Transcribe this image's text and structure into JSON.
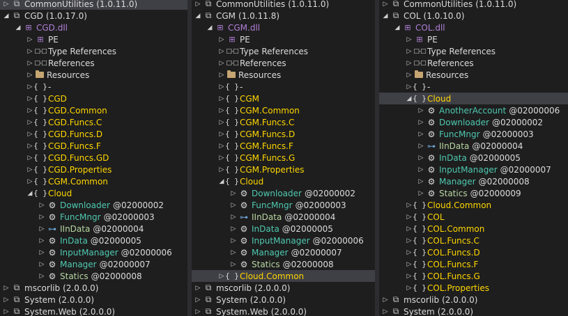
{
  "panels": [
    {
      "rows": [
        {
          "indent": 0,
          "exp": "▷",
          "icon": "assembly-icon",
          "label": "CommonUtilities",
          "version": "(1.0.11.0)",
          "kind": "plain",
          "sel": true
        },
        {
          "indent": 0,
          "exp": "◢",
          "icon": "assembly-icon",
          "label": "CGD",
          "version": "(1.0.17.0)",
          "kind": "plain"
        },
        {
          "indent": 1,
          "exp": "◢",
          "icon": "dll-icon",
          "label": "CGD.dll",
          "kind": "dll"
        },
        {
          "indent": 2,
          "exp": "▷",
          "icon": "pe-icon",
          "label": "PE",
          "kind": "plain"
        },
        {
          "indent": 2,
          "exp": "▷",
          "icon": "references-icon",
          "label": "Type References",
          "kind": "plain"
        },
        {
          "indent": 2,
          "exp": "▷",
          "icon": "references-icon",
          "label": "References",
          "kind": "plain"
        },
        {
          "indent": 2,
          "exp": "▷",
          "icon": "folder-icon",
          "label": "Resources",
          "kind": "plain"
        },
        {
          "indent": 2,
          "exp": "▷",
          "icon": "namespace-icon",
          "label": "-",
          "kind": "plain"
        },
        {
          "indent": 2,
          "exp": "▷",
          "icon": "namespace-icon",
          "label": "CGD",
          "kind": "ns"
        },
        {
          "indent": 2,
          "exp": "▷",
          "icon": "namespace-icon",
          "label": "CGD.Common",
          "kind": "ns"
        },
        {
          "indent": 2,
          "exp": "▷",
          "icon": "namespace-icon",
          "label": "CGD.Funcs.C",
          "kind": "ns"
        },
        {
          "indent": 2,
          "exp": "▷",
          "icon": "namespace-icon",
          "label": "CGD.Funcs.D",
          "kind": "ns"
        },
        {
          "indent": 2,
          "exp": "▷",
          "icon": "namespace-icon",
          "label": "CGD.Funcs.F",
          "kind": "ns"
        },
        {
          "indent": 2,
          "exp": "▷",
          "icon": "namespace-icon",
          "label": "CGD.Funcs.GD",
          "kind": "ns"
        },
        {
          "indent": 2,
          "exp": "▷",
          "icon": "namespace-icon",
          "label": "CGD.Properties",
          "kind": "ns"
        },
        {
          "indent": 2,
          "exp": "▷",
          "icon": "namespace-icon",
          "label": "CGM.Common",
          "kind": "ns"
        },
        {
          "indent": 2,
          "exp": "◢",
          "icon": "namespace-icon",
          "label": "Cloud",
          "kind": "ns"
        },
        {
          "indent": 3,
          "exp": "▷",
          "icon": "class-icon",
          "label": "Downloader",
          "token": "@02000002",
          "kind": "type"
        },
        {
          "indent": 3,
          "exp": "▷",
          "icon": "class-icon",
          "label": "FuncMngr",
          "token": "@02000003",
          "kind": "type"
        },
        {
          "indent": 3,
          "exp": "▷",
          "icon": "interface-icon",
          "label": "IInData",
          "token": "@02000004",
          "kind": "iface"
        },
        {
          "indent": 3,
          "exp": "▷",
          "icon": "class-icon",
          "label": "InData",
          "token": "@02000005",
          "kind": "type"
        },
        {
          "indent": 3,
          "exp": "▷",
          "icon": "class-icon",
          "label": "InputManager",
          "token": "@02000006",
          "kind": "type"
        },
        {
          "indent": 3,
          "exp": "▷",
          "icon": "class-icon",
          "label": "Manager",
          "token": "@02000007",
          "kind": "type"
        },
        {
          "indent": 3,
          "exp": "▷",
          "icon": "class-icon",
          "label": "Statics",
          "token": "@02000008",
          "kind": "iface"
        },
        {
          "indent": 0,
          "exp": "▷",
          "icon": "assembly-icon",
          "label": "mscorlib",
          "version": "(2.0.0.0)",
          "kind": "plain"
        },
        {
          "indent": 0,
          "exp": "▷",
          "icon": "assembly-icon",
          "label": "System",
          "version": "(2.0.0.0)",
          "kind": "plain"
        },
        {
          "indent": 0,
          "exp": "▷",
          "icon": "assembly-icon",
          "label": "System.Web",
          "version": "(2.0.0.0)",
          "kind": "plain"
        }
      ]
    },
    {
      "rows": [
        {
          "indent": 0,
          "exp": "▷",
          "icon": "assembly-icon",
          "label": "CommonUtilities",
          "version": "(1.0.11.0)",
          "kind": "plain"
        },
        {
          "indent": 0,
          "exp": "◢",
          "icon": "assembly-icon",
          "label": "CGM",
          "version": "(1.0.11.8)",
          "kind": "plain"
        },
        {
          "indent": 1,
          "exp": "◢",
          "icon": "dll-icon",
          "label": "CGM.dll",
          "kind": "dll"
        },
        {
          "indent": 2,
          "exp": "▷",
          "icon": "pe-icon",
          "label": "PE",
          "kind": "plain"
        },
        {
          "indent": 2,
          "exp": "▷",
          "icon": "references-icon",
          "label": "Type References",
          "kind": "plain"
        },
        {
          "indent": 2,
          "exp": "▷",
          "icon": "references-icon",
          "label": "References",
          "kind": "plain"
        },
        {
          "indent": 2,
          "exp": "▷",
          "icon": "folder-icon",
          "label": "Resources",
          "kind": "plain"
        },
        {
          "indent": 2,
          "exp": "▷",
          "icon": "namespace-icon",
          "label": "-",
          "kind": "plain"
        },
        {
          "indent": 2,
          "exp": "▷",
          "icon": "namespace-icon",
          "label": "CGM",
          "kind": "ns"
        },
        {
          "indent": 2,
          "exp": "▷",
          "icon": "namespace-icon",
          "label": "CGM.Common",
          "kind": "ns"
        },
        {
          "indent": 2,
          "exp": "▷",
          "icon": "namespace-icon",
          "label": "CGM.Funcs.C",
          "kind": "ns"
        },
        {
          "indent": 2,
          "exp": "▷",
          "icon": "namespace-icon",
          "label": "CGM.Funcs.D",
          "kind": "ns"
        },
        {
          "indent": 2,
          "exp": "▷",
          "icon": "namespace-icon",
          "label": "CGM.Funcs.F",
          "kind": "ns"
        },
        {
          "indent": 2,
          "exp": "▷",
          "icon": "namespace-icon",
          "label": "CGM.Funcs.G",
          "kind": "ns"
        },
        {
          "indent": 2,
          "exp": "▷",
          "icon": "namespace-icon",
          "label": "CGM.Properties",
          "kind": "ns"
        },
        {
          "indent": 2,
          "exp": "◢",
          "icon": "namespace-icon",
          "label": "Cloud",
          "kind": "ns"
        },
        {
          "indent": 3,
          "exp": "▷",
          "icon": "class-icon",
          "label": "Downloader",
          "token": "@02000002",
          "kind": "type"
        },
        {
          "indent": 3,
          "exp": "▷",
          "icon": "class-icon",
          "label": "FuncMngr",
          "token": "@02000003",
          "kind": "type"
        },
        {
          "indent": 3,
          "exp": "▷",
          "icon": "interface-icon",
          "label": "IInData",
          "token": "@02000004",
          "kind": "iface"
        },
        {
          "indent": 3,
          "exp": "▷",
          "icon": "class-icon",
          "label": "InData",
          "token": "@02000005",
          "kind": "type"
        },
        {
          "indent": 3,
          "exp": "▷",
          "icon": "class-icon",
          "label": "InputManager",
          "token": "@02000006",
          "kind": "type"
        },
        {
          "indent": 3,
          "exp": "▷",
          "icon": "class-icon",
          "label": "Manager",
          "token": "@02000007",
          "kind": "type"
        },
        {
          "indent": 3,
          "exp": "▷",
          "icon": "class-icon",
          "label": "Statics",
          "token": "@02000008",
          "kind": "iface"
        },
        {
          "indent": 2,
          "exp": "▷",
          "icon": "namespace-icon",
          "label": "Cloud.Common",
          "kind": "ns",
          "sel": true
        },
        {
          "indent": 0,
          "exp": "▷",
          "icon": "assembly-icon",
          "label": "mscorlib",
          "version": "(2.0.0.0)",
          "kind": "plain"
        },
        {
          "indent": 0,
          "exp": "▷",
          "icon": "assembly-icon",
          "label": "System",
          "version": "(2.0.0.0)",
          "kind": "plain"
        },
        {
          "indent": 0,
          "exp": "▷",
          "icon": "assembly-icon",
          "label": "System.Web",
          "version": "(2.0.0.0)",
          "kind": "plain"
        }
      ]
    },
    {
      "rows": [
        {
          "indent": 0,
          "exp": "▷",
          "icon": "assembly-icon",
          "label": "CommonUtilities",
          "version": "(1.0.11.0)",
          "kind": "plain"
        },
        {
          "indent": 0,
          "exp": "◢",
          "icon": "assembly-icon",
          "label": "COL",
          "version": "(1.0.10.0)",
          "kind": "plain"
        },
        {
          "indent": 1,
          "exp": "◢",
          "icon": "dll-icon",
          "label": "COL.dll",
          "kind": "dll"
        },
        {
          "indent": 2,
          "exp": "▷",
          "icon": "pe-icon",
          "label": "PE",
          "kind": "plain"
        },
        {
          "indent": 2,
          "exp": "▷",
          "icon": "references-icon",
          "label": "Type References",
          "kind": "plain"
        },
        {
          "indent": 2,
          "exp": "▷",
          "icon": "references-icon",
          "label": "References",
          "kind": "plain"
        },
        {
          "indent": 2,
          "exp": "▷",
          "icon": "folder-icon",
          "label": "Resources",
          "kind": "plain"
        },
        {
          "indent": 2,
          "exp": "▷",
          "icon": "namespace-icon",
          "label": "-",
          "kind": "plain"
        },
        {
          "indent": 2,
          "exp": "◢",
          "icon": "namespace-icon",
          "label": "Cloud",
          "kind": "ns",
          "sel": true
        },
        {
          "indent": 3,
          "exp": "▷",
          "icon": "class-icon",
          "label": "AnotherAccount",
          "token": "@02000006",
          "kind": "type"
        },
        {
          "indent": 3,
          "exp": "▷",
          "icon": "class-icon",
          "label": "Downloader",
          "token": "@02000002",
          "kind": "type"
        },
        {
          "indent": 3,
          "exp": "▷",
          "icon": "class-icon",
          "label": "FuncMngr",
          "token": "@02000003",
          "kind": "type"
        },
        {
          "indent": 3,
          "exp": "▷",
          "icon": "interface-icon",
          "label": "IInData",
          "token": "@02000004",
          "kind": "iface"
        },
        {
          "indent": 3,
          "exp": "▷",
          "icon": "class-icon",
          "label": "InData",
          "token": "@02000005",
          "kind": "type"
        },
        {
          "indent": 3,
          "exp": "▷",
          "icon": "class-icon",
          "label": "InputManager",
          "token": "@02000007",
          "kind": "type"
        },
        {
          "indent": 3,
          "exp": "▷",
          "icon": "class-icon",
          "label": "Manager",
          "token": "@02000008",
          "kind": "type"
        },
        {
          "indent": 3,
          "exp": "▷",
          "icon": "class-icon",
          "label": "Statics",
          "token": "@02000009",
          "kind": "iface"
        },
        {
          "indent": 2,
          "exp": "▷",
          "icon": "namespace-icon",
          "label": "Cloud.Common",
          "kind": "ns"
        },
        {
          "indent": 2,
          "exp": "▷",
          "icon": "namespace-icon",
          "label": "COL",
          "kind": "ns"
        },
        {
          "indent": 2,
          "exp": "▷",
          "icon": "namespace-icon",
          "label": "COL.Common",
          "kind": "ns"
        },
        {
          "indent": 2,
          "exp": "▷",
          "icon": "namespace-icon",
          "label": "COL.Funcs.C",
          "kind": "ns"
        },
        {
          "indent": 2,
          "exp": "▷",
          "icon": "namespace-icon",
          "label": "COL.Funcs.D",
          "kind": "ns"
        },
        {
          "indent": 2,
          "exp": "▷",
          "icon": "namespace-icon",
          "label": "COL.Funcs.F",
          "kind": "ns"
        },
        {
          "indent": 2,
          "exp": "▷",
          "icon": "namespace-icon",
          "label": "COL.Funcs.G",
          "kind": "ns"
        },
        {
          "indent": 2,
          "exp": "▷",
          "icon": "namespace-icon",
          "label": "COL.Properties",
          "kind": "ns"
        },
        {
          "indent": 0,
          "exp": "▷",
          "icon": "assembly-icon",
          "label": "mscorlib",
          "version": "(2.0.0.0)",
          "kind": "plain"
        },
        {
          "indent": 0,
          "exp": "▷",
          "icon": "assembly-icon",
          "label": "System",
          "version": "(2.0.0.0)",
          "kind": "plain"
        }
      ]
    }
  ],
  "colors": {
    "background": "#1e1e1e",
    "selection": "#3f3f46",
    "namespace": "#ffd700",
    "type": "#4ec9b0",
    "interface": "#b8d7a3",
    "dll": "#b180d7"
  }
}
